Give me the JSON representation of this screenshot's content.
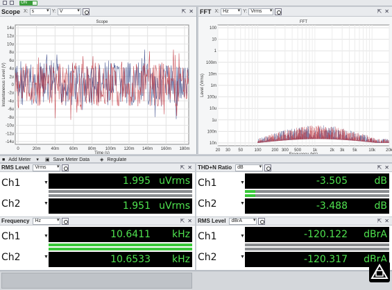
{
  "top_toolbar": {
    "on_label": "ON"
  },
  "scope": {
    "title": "Scope",
    "x_axis_label": "X:",
    "x_unit": "s",
    "y_axis_label": "Y:",
    "y_unit": "V",
    "plot_title": "Scope",
    "xlabel": "Time (s)",
    "ylabel": "Instantaneous Level (V)",
    "yticks": [
      "14u",
      "12u",
      "10u",
      "8u",
      "6u",
      "4u",
      "2u",
      "0",
      "-2u",
      "-4u",
      "-6u",
      "-8u",
      "-10u",
      "-12u",
      "-14u"
    ],
    "xticks": [
      "0",
      "20m",
      "40m",
      "60m",
      "80m",
      "100m",
      "120m",
      "140m",
      "160m",
      "180m"
    ]
  },
  "fft": {
    "title": "FFT",
    "x_axis_label": "X:",
    "x_unit": "Hz",
    "y_axis_label": "Y:",
    "y_unit": "Vrms",
    "plot_title": "FFT",
    "xlabel": "Frequency (Hz)",
    "ylabel": "Level (Vrms)",
    "yticks": [
      "100",
      "10",
      "1",
      "100m",
      "10m",
      "1m",
      "100u",
      "10u",
      "1u",
      "100n",
      "10n"
    ],
    "xticks": [
      "20",
      "30",
      "50",
      "100",
      "200",
      "300",
      "500",
      "1k",
      "2k",
      "3k",
      "5k",
      "10k",
      "20k"
    ]
  },
  "meter_toolbar": {
    "add_meter": "Add Meter",
    "save_meter_data": "Save Meter Data",
    "regulate": "Regulate"
  },
  "meters": {
    "rms_level": {
      "title": "RMS Level",
      "unit_select": "Vrms",
      "channels": [
        {
          "label": "Ch1",
          "value": "1.995",
          "unit": "uVrms",
          "level": 0.0
        },
        {
          "label": "Ch2",
          "value": "1.951",
          "unit": "uVrms",
          "level": 0.0
        }
      ]
    },
    "thd_n": {
      "title": "THD+N Ratio",
      "unit_select": "dB",
      "channels": [
        {
          "label": "Ch1",
          "value": "-3.505",
          "unit": "dB",
          "level": 0.07
        },
        {
          "label": "Ch2",
          "value": "-3.488",
          "unit": "dB",
          "level": 0.07
        }
      ]
    },
    "frequency": {
      "title": "Frequency",
      "unit_select": "Hz",
      "channels": [
        {
          "label": "Ch1",
          "value": "10.6411",
          "unit": "kHz",
          "level": 1.0
        },
        {
          "label": "Ch2",
          "value": "10.6533",
          "unit": "kHz",
          "level": 1.0
        }
      ]
    },
    "rms_level_dbra": {
      "title": "RMS Level",
      "unit_select": "dBrA",
      "channels": [
        {
          "label": "Ch1",
          "value": "-120.122",
          "unit": "dBrA",
          "level": 0.0
        },
        {
          "label": "Ch2",
          "value": "-120.317",
          "unit": "dBrA",
          "level": 0.0
        }
      ]
    }
  },
  "colors": {
    "readout_green": "#4fe34f",
    "trace_red": "#c0303a",
    "trace_blue": "#3b4a8a",
    "bar_green": "#39c739"
  }
}
